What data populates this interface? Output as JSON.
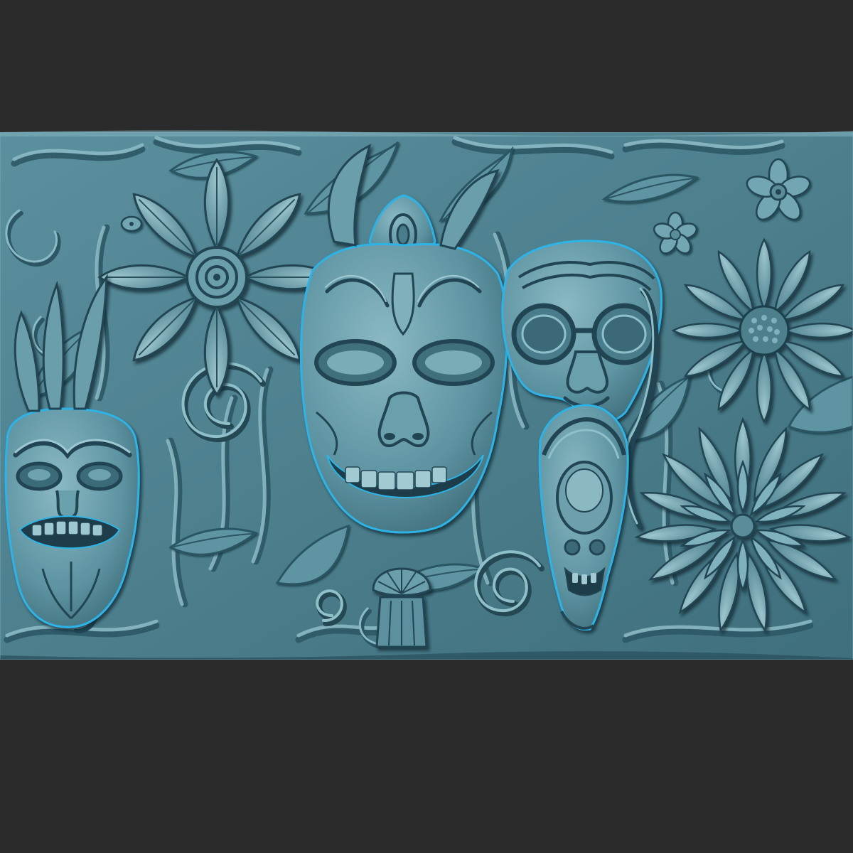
{
  "image": {
    "subject": "carved-relief-panel",
    "colors": {
      "background": "#2b2b2c",
      "relief_base": "#4f8291",
      "relief_mid": "#6d9fad",
      "relief_light": "#a6ccd4",
      "relief_deep": "#234552",
      "rim_highlight": "#2fb3e6"
    },
    "elements": [
      "tiki-mask-left",
      "skull-mask-center",
      "goggle-mask-right",
      "small-tiki-figure",
      "flower-top-left",
      "flower-right",
      "chrysanthemum-bottom-right",
      "spiral-ornaments",
      "leaf-foliage"
    ]
  }
}
